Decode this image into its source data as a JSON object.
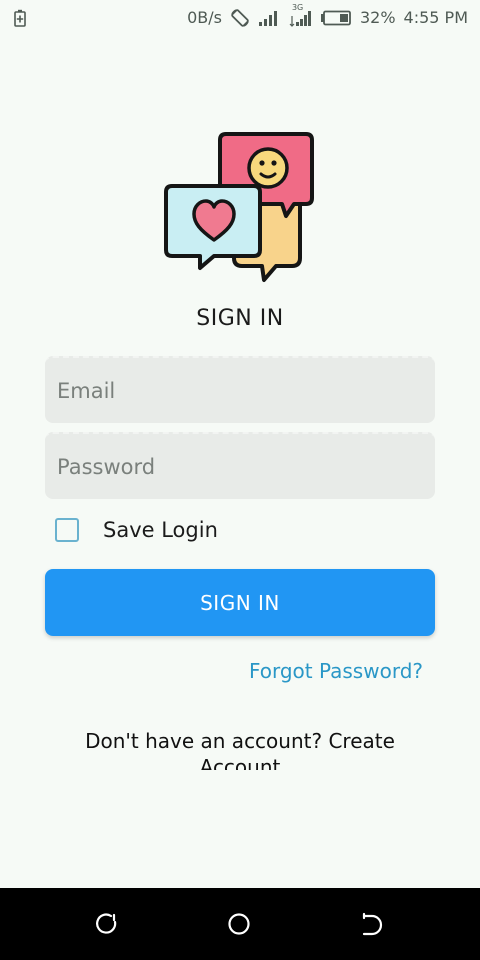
{
  "status_bar": {
    "left_icon": "battery-saver-icon",
    "net_speed": "0B/s",
    "network_type": "3G",
    "battery_percent": "32%",
    "time": "4:55 PM"
  },
  "logo": {
    "icon": "chat-bubbles-logo"
  },
  "title": "SIGN IN",
  "email": {
    "placeholder": "Email",
    "value": ""
  },
  "password": {
    "placeholder": "Password",
    "value": ""
  },
  "save_login": {
    "label": "Save Login",
    "checked": false
  },
  "signin_button": {
    "label": "SIGN IN"
  },
  "forgot_password": {
    "label": "Forgot Password?"
  },
  "create_account": {
    "text": "Don't have an account? Create Account"
  },
  "colors": {
    "background": "#f6faf6",
    "primary": "#2196f3",
    "link": "#2a97c7",
    "field_bg": "#e8ebe8",
    "checkbox_border": "#6ab2cf"
  }
}
